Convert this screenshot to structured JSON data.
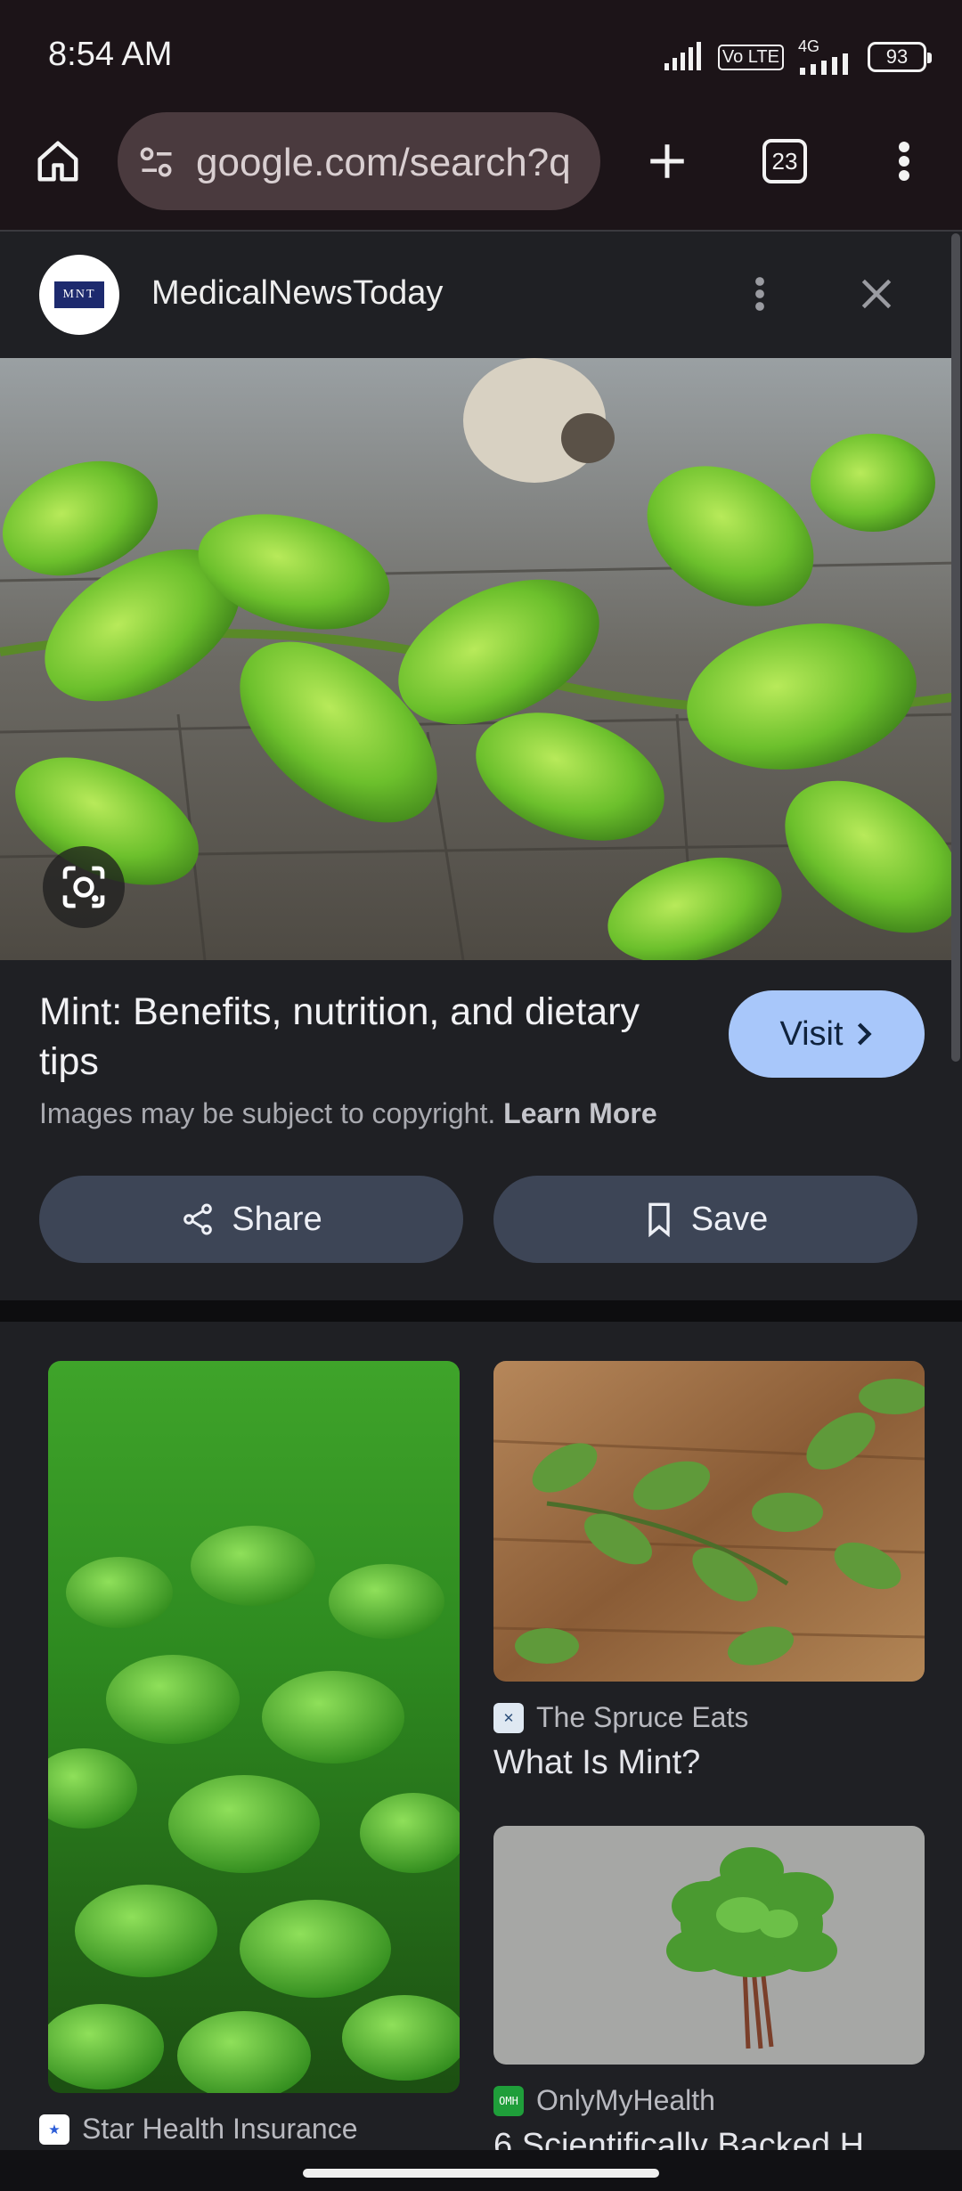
{
  "status_bar": {
    "time": "8:54 AM",
    "network": "4G",
    "volte": "Vo LTE",
    "battery": "93"
  },
  "browser": {
    "url": "google.com/search?q",
    "tab_count": "23"
  },
  "source": {
    "name": "MedicalNewsToday",
    "logo_text": "MNT"
  },
  "result": {
    "title": "Mint: Benefits, nutrition, and dietary tips",
    "visit_label": "Visit",
    "copyright_text": "Images may be subject to copyright.",
    "learn_more": "Learn More",
    "share_label": "Share",
    "save_label": "Save"
  },
  "related": [
    {
      "source": "Star Health Insurance",
      "title": ""
    },
    {
      "source": "The Spruce Eats",
      "title": "What Is Mint?"
    },
    {
      "source": "OnlyMyHealth",
      "source_logo": "OMH",
      "title": "6 Scientifically Backed H"
    }
  ],
  "colors": {
    "accent": "#a8c7fa",
    "pill": "#3d4556",
    "background": "#1f2024",
    "toolbar": "#1c1418"
  }
}
